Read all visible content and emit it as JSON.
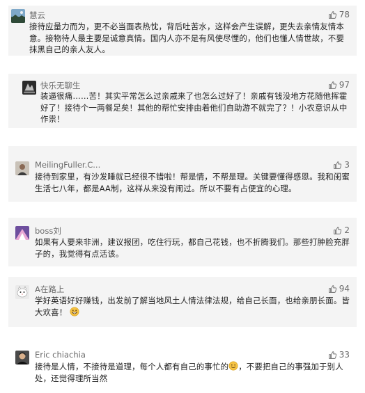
{
  "comments": [
    {
      "user": "慧云",
      "avatar": "avatar-landscape-icon",
      "likes": "78",
      "text": "接待应量力而为，更不必当面表热忱，背后吐苦水，这样会产生误解，更失去亲情友情本意。接物待人最主要是诚意真情。国内人亦不是有风使尽悝的，他们也懂人情世故，不要抹黑自己的亲人友人。"
    },
    {
      "user": "快乐无聊生",
      "avatar": "avatar-dark-icon",
      "likes": "97",
      "text": "装逼很痛……苦！其实平常怎么过亲戚来了也怎么过好了！亲戚有钱没地方花随他挥霍好了！接待个一两餐足矣！其他的帮忙安排由着他们自助游不就完了？！小农意识从中作祟！"
    },
    {
      "user": "MeilingFuller.C...",
      "avatar": "avatar-person-icon",
      "likes": "3",
      "text": "接待到家里，有沙发睡就已经很不错啦！帮是情，不帮是理。关键要懂得感恩。我和闺蜜生活七八年，都是AA制，这样从来没有闹过。所以不要有占便宜的心理。"
    },
    {
      "user": "boss刘",
      "avatar": "avatar-purple-icon",
      "likes": "2",
      "text": "如果有人要来非洲，建议报团，吃住行玩，都自己花钱，也不折腾我们。那些打肿脸充胖子的，我觉得有点活该。"
    },
    {
      "user": "A在路上",
      "avatar": "avatar-cat-icon",
      "likes": "94",
      "text": "学好英语好好赚钱，出发前了解当地风土人情法律法规，给自己长面，也给亲朋长面。皆大欢喜！",
      "emoji": "grinning-emoji-icon"
    },
    {
      "user": "Eric chiachia",
      "avatar": "avatar-man-icon",
      "likes": "33",
      "text_before": "接待是人情，不接待是道理，每个人都有自己的事忙的",
      "emoji": "smile-emoji-icon",
      "text_after": "，不要把自己的事强加于别人处，还觉得理所当然"
    }
  ]
}
